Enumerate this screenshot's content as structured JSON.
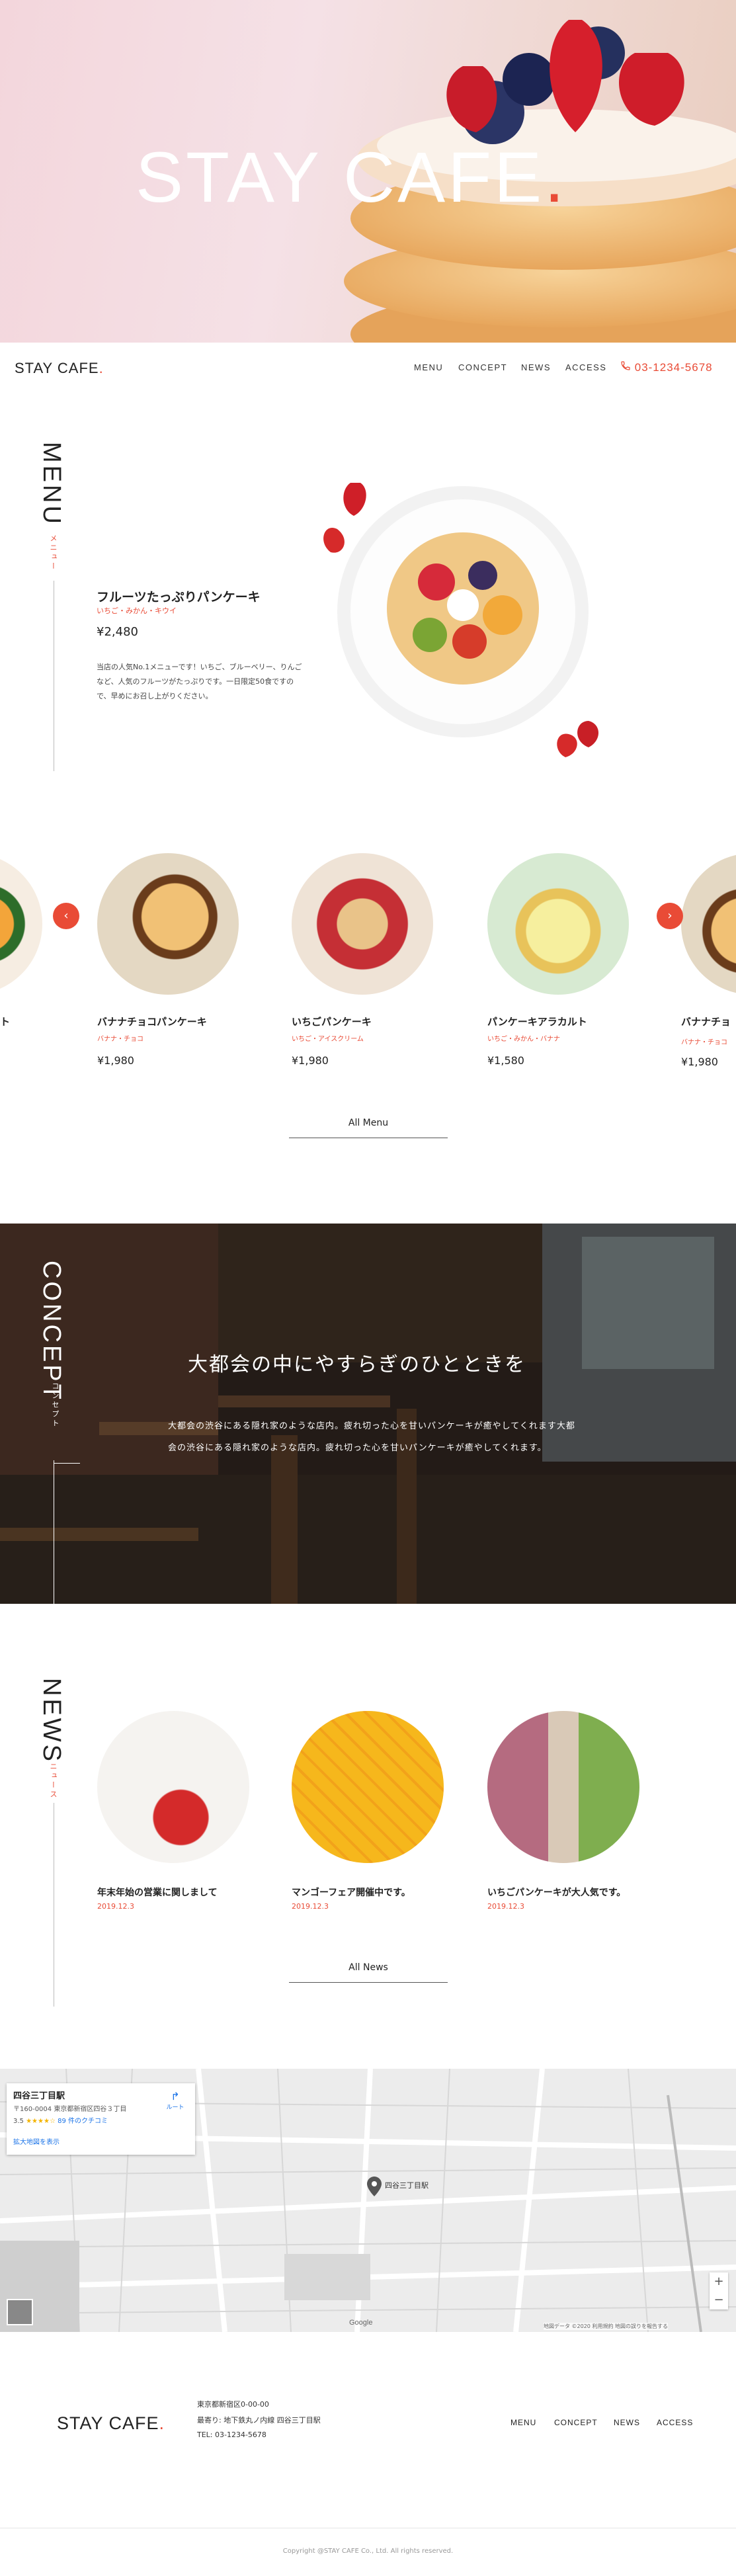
{
  "hero": {
    "title": "STAY CAFE",
    "title_dot": "."
  },
  "header": {
    "logo": "STAY CAFE",
    "logo_dot": ".",
    "nav": [
      "MENU",
      "CONCEPT",
      "NEWS",
      "ACCESS"
    ],
    "phone": "03-1234-5678"
  },
  "menu": {
    "label": "MENU",
    "sublabel": "メニュー",
    "featured": {
      "name": "フルーツたっぷりパンケーキ",
      "ingredients": "いちご・みかん・キウイ",
      "price": "¥2,480",
      "description": "当店の人気No.1メニューです！いちご、ブルーベリー、りんごなど、人気のフルーツがたっぷりです。一日限定50食ですので、早めにお召し上がりください。"
    },
    "items": [
      {
        "name": "バナナチョコパンケーキ",
        "ingredients": "バナナ・チョコ",
        "price": "¥1,980"
      },
      {
        "name": "いちごパンケーキ",
        "ingredients": "いちご・アイスクリーム",
        "price": "¥1,980"
      },
      {
        "name": "パンケーキアラカルト",
        "ingredients": "いちご・みかん・バナナ",
        "price": "¥1,580"
      },
      {
        "name": "バナナチョ",
        "ingredients": "バナナ・チョコ",
        "price": "¥1,980"
      }
    ],
    "partial_left_name": "ト",
    "all_link": "All Menu"
  },
  "concept": {
    "label": "CONCEPT",
    "sublabel": "コンセプト",
    "heading": "大都会の中にやすらぎのひとときを",
    "body": "大都会の渋谷にある隠れ家のような店内。疲れ切った心を甘いパンケーキが癒やしてくれます大都会の渋谷にある隠れ家のような店内。疲れ切った心を甘いパンケーキが癒やしてくれます。"
  },
  "news": {
    "label": "NEWS",
    "sublabel": "ニュース",
    "items": [
      {
        "title": "年末年始の営業に関しまして",
        "date": "2019.12.3"
      },
      {
        "title": "マンゴーフェア開催中です。",
        "date": "2019.12.3"
      },
      {
        "title": "いちごパンケーキが大人気です。",
        "date": "2019.12.3"
      }
    ],
    "all_link": "All News"
  },
  "map": {
    "place_name": "四谷三丁目駅",
    "address": "〒160-0004 東京都新宿区四谷３丁目",
    "rating": "3.5",
    "stars": "★★★★☆",
    "reviews": "89 件のクチコミ",
    "directions_label": "ルート",
    "view_larger": "拡大地図を表示",
    "station_label": "四谷三丁目駅",
    "zoom_in": "+",
    "zoom_out": "−",
    "google": "Google",
    "attribution": "地図データ ©2020  利用規約  地図の誤りを報告する"
  },
  "footer": {
    "logo": "STAY CAFE",
    "logo_dot": ".",
    "address": "東京都新宿区0-00-00",
    "station": "最寄り: 地下鉄丸ノ内線 四谷三丁目駅",
    "tel": "TEL: 03-1234-5678",
    "nav": [
      "MENU",
      "CONCEPT",
      "NEWS",
      "ACCESS"
    ],
    "copyright": "Copyright @STAY CAFE Co., Ltd. All rights reserved."
  },
  "colors": {
    "accent": "#e94b36",
    "text": "#222222"
  }
}
